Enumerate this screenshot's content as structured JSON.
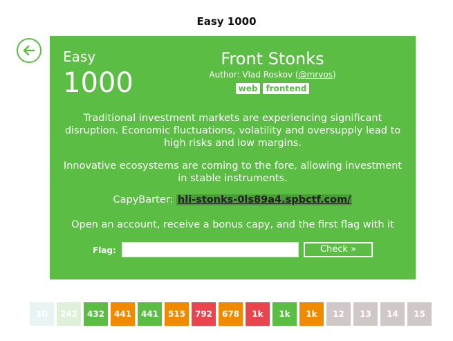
{
  "header": {
    "title": "Easy 1000"
  },
  "task": {
    "category": "Easy",
    "points": "1000",
    "title": "Front Stonks",
    "author_prefix": "Author: Vlad Roskov (",
    "author_handle": "@mrvos",
    "author_suffix": ")",
    "tags": [
      "web",
      "frontend"
    ],
    "description_1": "Traditional investment markets are experiencing significant disruption. Economic fluctuations, volatility and oversupply lead to high risks and low margins.",
    "description_2": "Innovative ecosystems are coming to the fore, allowing investment in stable instruments.",
    "link_label": "CapyBarter:",
    "link_url": "hli-stonks-0ls89a4.spbctf.com/",
    "description_3": "Open an account, receive a bonus capy, and the first flag with it"
  },
  "flag_form": {
    "label": "Flag:",
    "value": "",
    "placeholder": "",
    "submit_label": "Check »"
  },
  "colors": {
    "accent": "#5bbd44",
    "tile_green": "#5bbd44",
    "tile_orange": "#f08a00",
    "tile_red": "#e8454f",
    "tile_gray": "#d0c8c8",
    "tile_pale_blue": "#e8f4f4",
    "tile_pale_green": "#dff0d8"
  },
  "task_tiles": [
    {
      "label": "10",
      "color": "#e8f4f4"
    },
    {
      "label": "242",
      "color": "#dff0d8"
    },
    {
      "label": "432",
      "color": "#5bbd44"
    },
    {
      "label": "441",
      "color": "#f08a00"
    },
    {
      "label": "441",
      "color": "#5bbd44"
    },
    {
      "label": "515",
      "color": "#f08a00"
    },
    {
      "label": "792",
      "color": "#e8454f"
    },
    {
      "label": "678",
      "color": "#f08a00"
    },
    {
      "label": "1k",
      "color": "#e8454f"
    },
    {
      "label": "1k",
      "color": "#5bbd44"
    },
    {
      "label": "1k",
      "color": "#f08a00"
    },
    {
      "label": "12",
      "color": "#d0c8c8"
    },
    {
      "label": "13",
      "color": "#d0c8c8"
    },
    {
      "label": "14",
      "color": "#d0c8c8"
    },
    {
      "label": "15",
      "color": "#d0c8c8"
    }
  ]
}
